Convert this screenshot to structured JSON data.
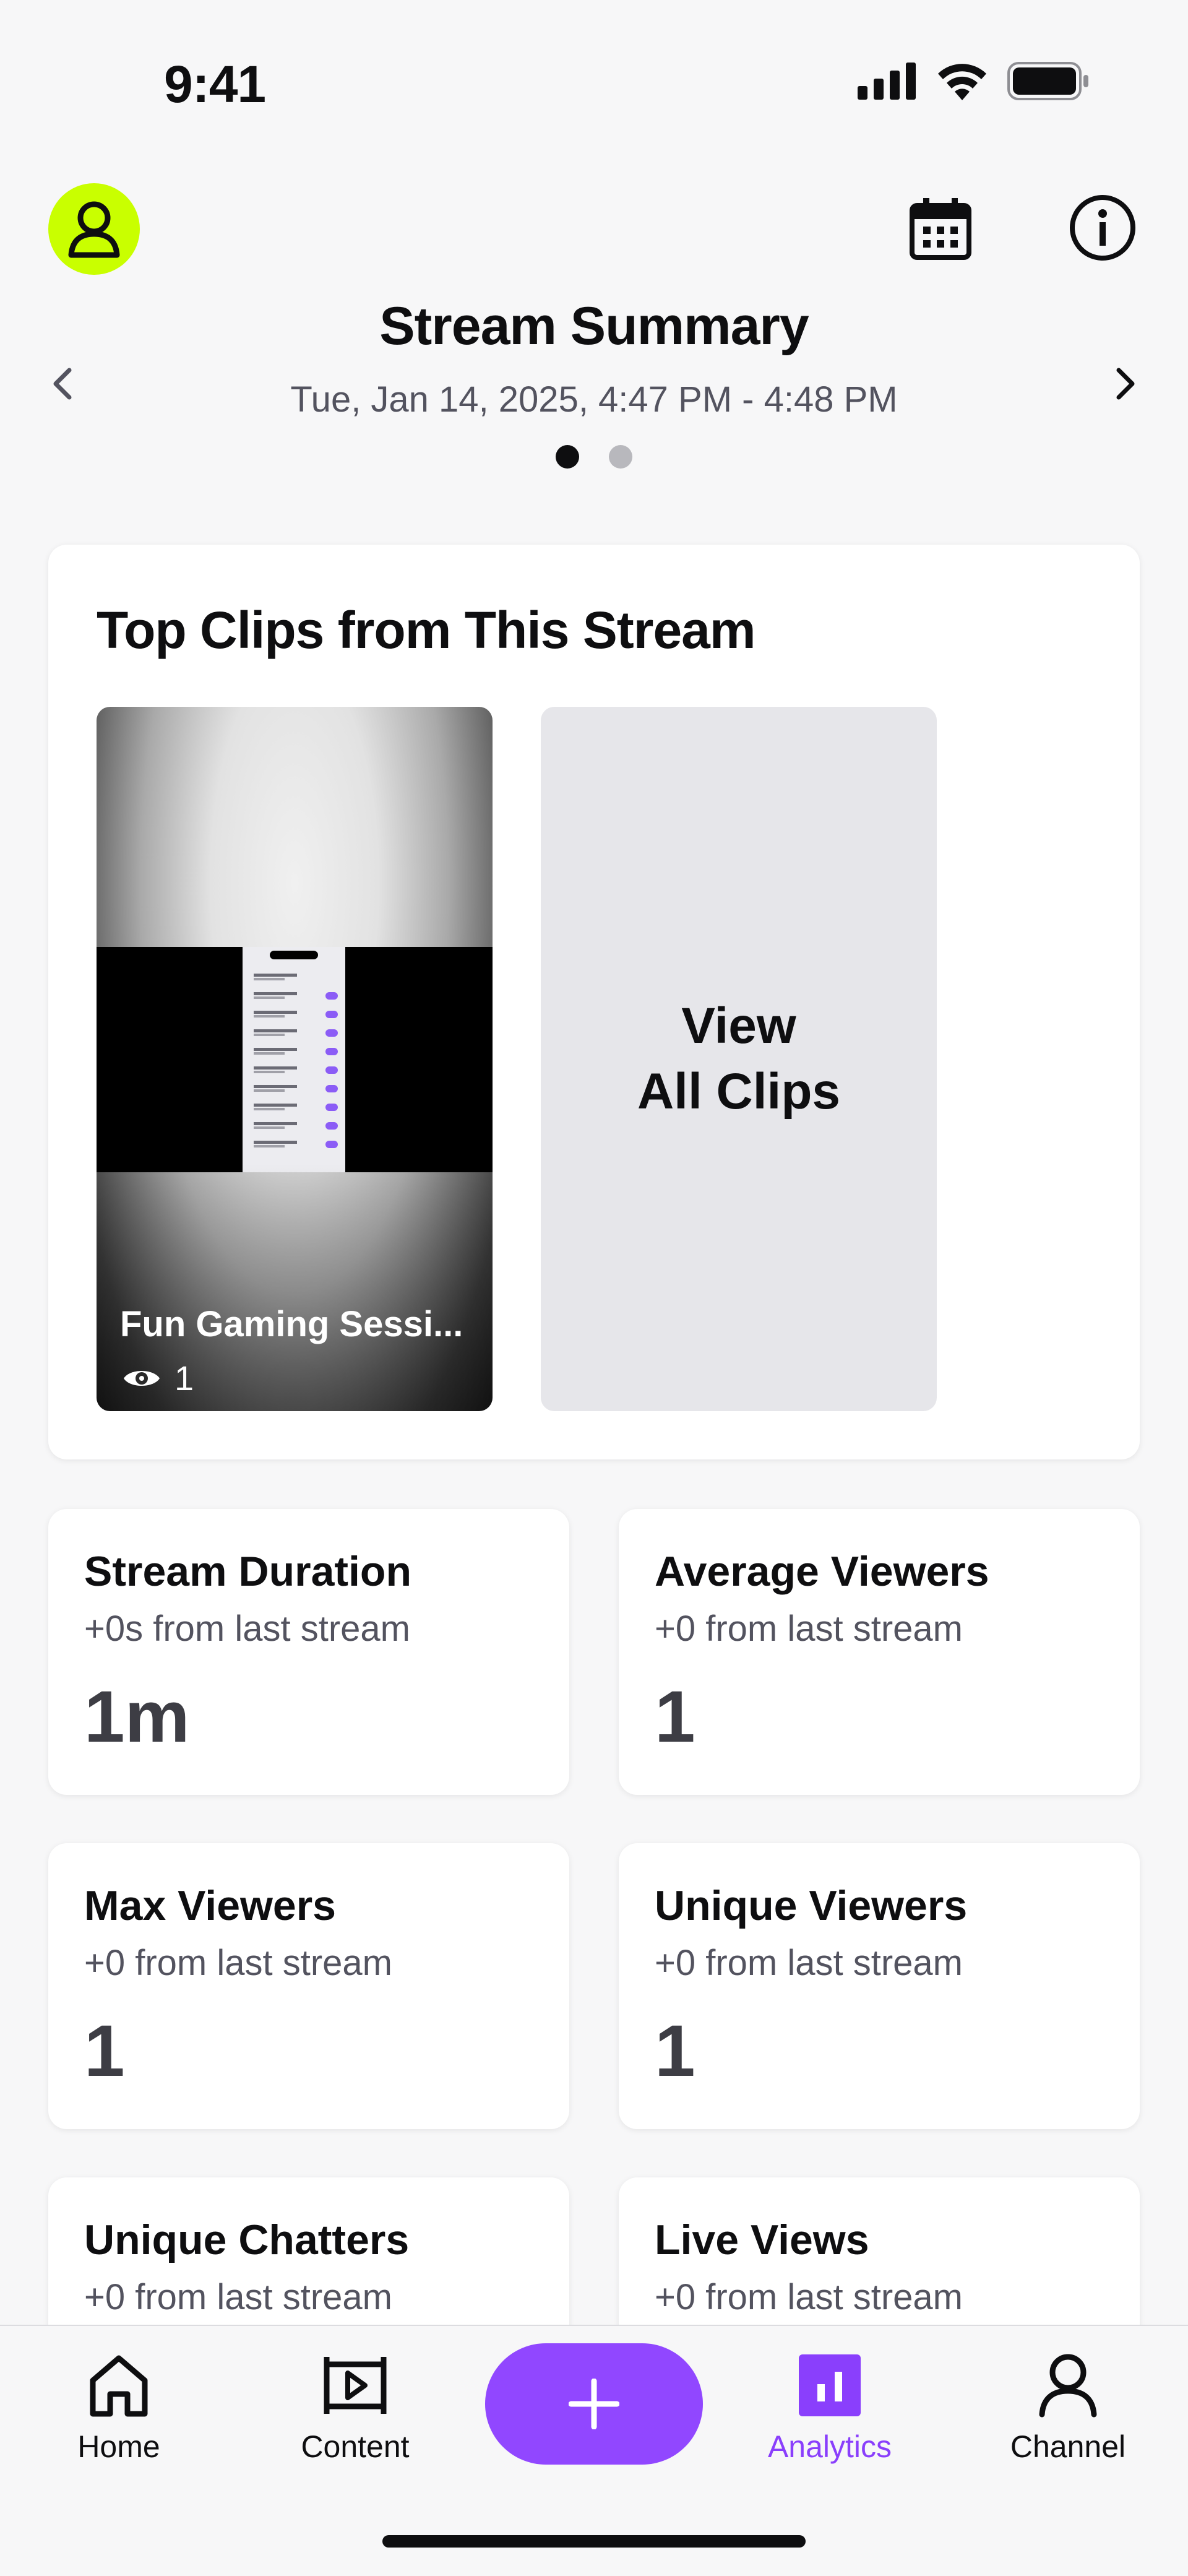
{
  "status_bar": {
    "time": "9:41"
  },
  "header": {
    "title": "Stream Summary",
    "subtitle": "Tue, Jan 14, 2025, 4:47 PM - 4:48 PM",
    "pages_total": 2,
    "page_current": 1
  },
  "clips": {
    "title": "Top Clips from This Stream",
    "items": [
      {
        "title": "Fun Gaming Sessi...",
        "views": "1"
      }
    ],
    "view_all_label": "View\nAll Clips"
  },
  "stats": [
    {
      "label": "Stream Duration",
      "delta": "+0s from last stream",
      "value": "1m"
    },
    {
      "label": "Average Viewers",
      "delta": "+0 from last stream",
      "value": "1"
    },
    {
      "label": "Max Viewers",
      "delta": "+0 from last stream",
      "value": "1"
    },
    {
      "label": "Unique Viewers",
      "delta": "+0 from last stream",
      "value": "1"
    },
    {
      "label": "Unique Chatters",
      "delta": "+0 from last stream",
      "value": ""
    },
    {
      "label": "Live Views",
      "delta": "+0 from last stream",
      "value": ""
    }
  ],
  "bottom_nav": {
    "items": [
      {
        "label": "Home",
        "icon": "home-icon"
      },
      {
        "label": "Content",
        "icon": "film-icon"
      },
      {
        "label": "Analytics",
        "icon": "analytics-icon",
        "active": true
      },
      {
        "label": "Channel",
        "icon": "person-icon"
      }
    ],
    "create_icon": "plus-icon"
  },
  "colors": {
    "accent": "#9147ff",
    "accent_text": "#8a3ffc",
    "avatar_bg": "#c9ff00",
    "background": "#f7f7f8"
  }
}
